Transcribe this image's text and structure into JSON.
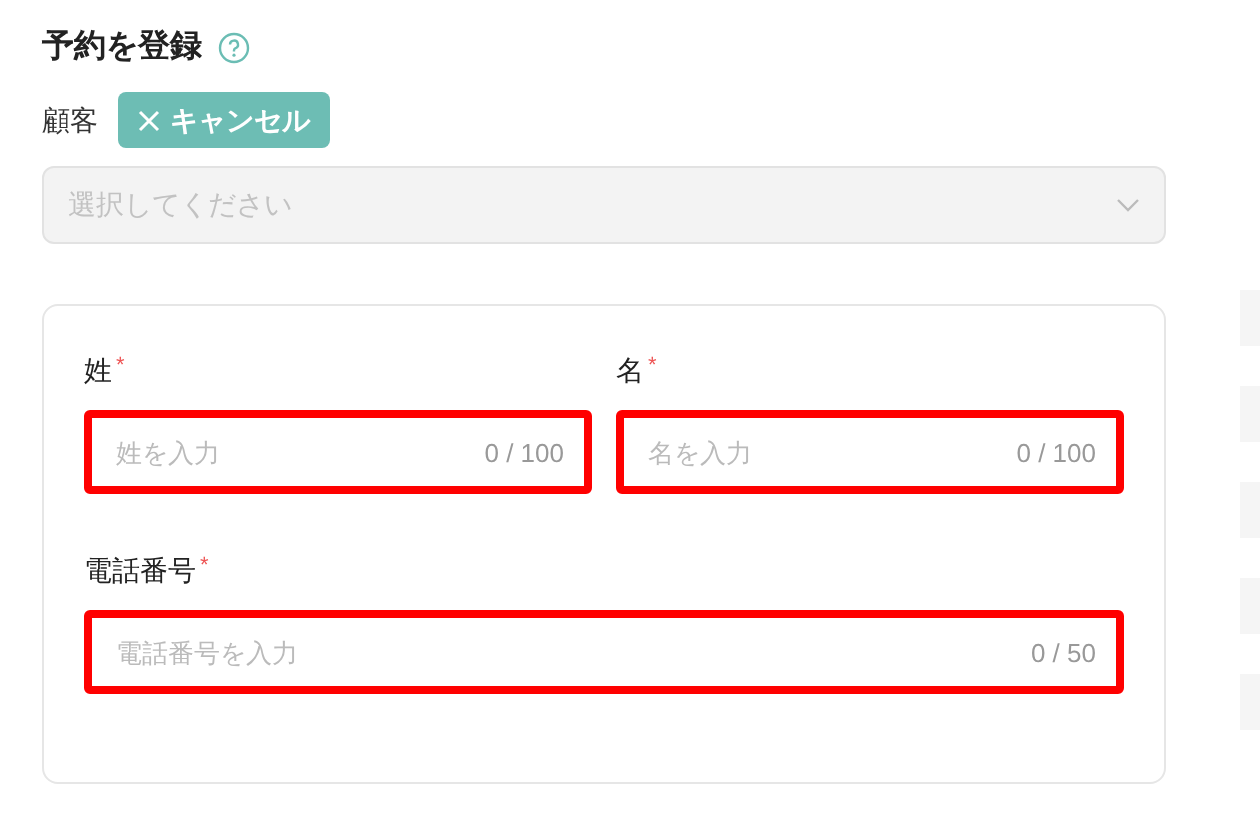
{
  "title": "予約を登録",
  "customer": {
    "label": "顧客",
    "cancel_button": "キャンセル",
    "select": {
      "placeholder": "選択してください"
    }
  },
  "fields": [
    {
      "label": "姓",
      "required_mark": "*",
      "placeholder": "姓を入力",
      "counter": "0 / 100",
      "highlighted": true
    },
    {
      "label": "名",
      "required_mark": "*",
      "placeholder": "名を入力",
      "counter": "0 / 100",
      "highlighted": true
    },
    {
      "label": "電話番号",
      "required_mark": "*",
      "placeholder": "電話番号を入力",
      "counter": "0 / 50",
      "highlighted": true
    }
  ]
}
